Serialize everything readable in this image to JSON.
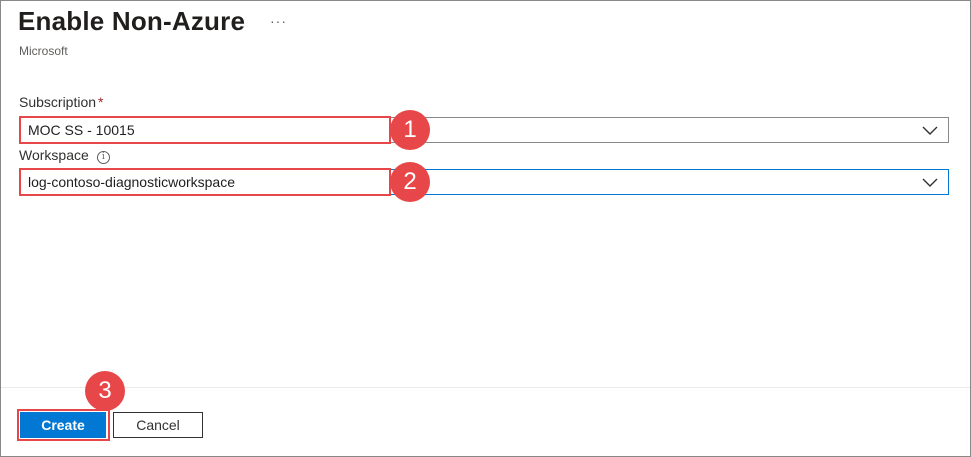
{
  "header": {
    "title": "Enable Non-Azure",
    "more_label": "···",
    "subtitle": "Microsoft"
  },
  "form": {
    "subscription": {
      "label": "Subscription",
      "required_marker": "*",
      "value": "MOC SS - 10015"
    },
    "workspace": {
      "label": "Workspace",
      "info_glyph": "i",
      "value": "log-contoso-diagnosticworkspace"
    }
  },
  "annotations": {
    "step1": "1",
    "step2": "2",
    "step3": "3",
    "color": "#e8474a"
  },
  "footer": {
    "create_label": "Create",
    "cancel_label": "Cancel"
  },
  "colors": {
    "accent": "#0078d4",
    "required": "#a4262c"
  }
}
